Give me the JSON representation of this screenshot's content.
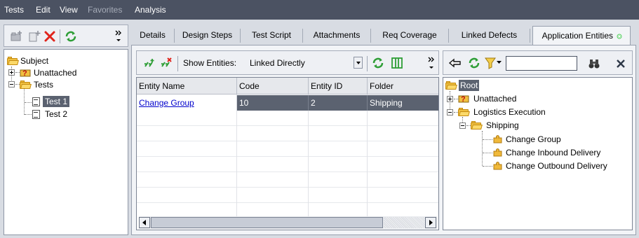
{
  "menu": {
    "items": [
      {
        "label": "Tests",
        "enabled": true
      },
      {
        "label": "Edit",
        "enabled": true
      },
      {
        "label": "View",
        "enabled": true
      },
      {
        "label": "Favorites",
        "enabled": false
      },
      {
        "label": "Analysis",
        "enabled": true
      }
    ]
  },
  "left_toolbar": {
    "icons": [
      "new-folder-icon",
      "new-test-icon",
      "delete-icon",
      "refresh-icon",
      "more-chevron-icon"
    ]
  },
  "test_tree": {
    "root": "Subject",
    "nodes": [
      "Unattached",
      "Tests",
      "Test 1",
      "Test 2"
    ],
    "selected": "Test 1"
  },
  "tabs": [
    {
      "label": "Details",
      "active": false
    },
    {
      "label": "Design Steps",
      "active": false
    },
    {
      "label": "Test Script",
      "active": false
    },
    {
      "label": "Attachments",
      "active": false
    },
    {
      "label": "Req Coverage",
      "active": false
    },
    {
      "label": "Linked Defects",
      "active": false
    },
    {
      "label": "Application Entities",
      "active": true
    }
  ],
  "entities_toolbar": {
    "show_label": "Show Entities:",
    "show_value": "Linked Directly"
  },
  "entities_grid": {
    "columns": [
      "Entity Name",
      "Code",
      "Entity ID",
      "Folder"
    ],
    "rows": [
      {
        "entity_name": "Change Group",
        "code": "10",
        "entity_id": "2",
        "folder": "Shipping"
      }
    ]
  },
  "entity_tree": {
    "root": "Root",
    "nodes": [
      "Unattached",
      "Logistics Execution",
      "Shipping",
      "Change Group",
      "Change Inbound Delivery",
      "Change Outbound Delivery"
    ]
  },
  "search": {
    "value": ""
  },
  "colors": {
    "menubar": "#4b5262",
    "selection": "#5b6270",
    "link": "#0000cc"
  }
}
